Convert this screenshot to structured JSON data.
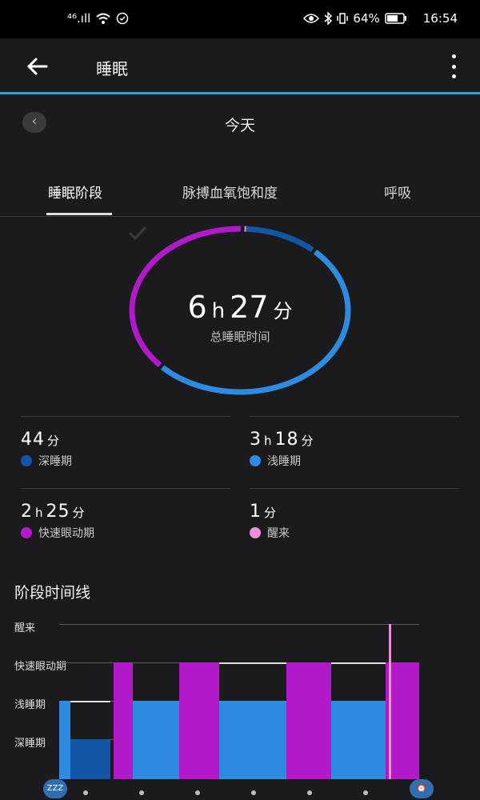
{
  "status_bar": {
    "left_text": "⁴⁶.ıll",
    "battery": "64%",
    "time": "16:54"
  },
  "header": {
    "title": "睡眠"
  },
  "date_nav": {
    "label": "今天"
  },
  "tabs": [
    {
      "label": "睡眠阶段",
      "active": true
    },
    {
      "label": "脉搏血氧饱和度",
      "active": false
    },
    {
      "label": "呼吸",
      "active": false
    }
  ],
  "summary": {
    "hours": "6",
    "hours_unit": "h",
    "minutes": "27",
    "minutes_unit": "分",
    "label": "总睡眠时间"
  },
  "stages": [
    {
      "value_main": "44",
      "value_unit": "分",
      "value_h": "",
      "value_h_unit": "",
      "label": "深睡期",
      "color": "#1356a6"
    },
    {
      "value_main": "18",
      "value_unit": "分",
      "value_h": "3",
      "value_h_unit": "h",
      "label": "浅睡期",
      "color": "#2f8be0"
    },
    {
      "value_main": "25",
      "value_unit": "分",
      "value_h": "2",
      "value_h_unit": "h",
      "label": "快速眼动期",
      "color": "#b21ac9"
    },
    {
      "value_main": "1",
      "value_unit": "分",
      "value_h": "",
      "value_h_unit": "",
      "label": "醒来",
      "color": "#f08fd8"
    }
  ],
  "timeline": {
    "title": "阶段时间线",
    "levels": [
      "醒来",
      "快速眼动期",
      "浅睡期",
      "深睡期"
    ],
    "start_icon": "zzz-icon",
    "end_icon": "alarm-clock-icon",
    "colors": {
      "deep": "#1356a6",
      "light": "#2f8be0",
      "rem": "#b21ac9",
      "awake": "#f08fd8"
    }
  },
  "chart_data": {
    "type": "bar",
    "title": "阶段时间线",
    "categories": [
      "醒来",
      "快速眼动期",
      "浅睡期",
      "深睡期"
    ],
    "donut": {
      "series": [
        {
          "name": "深睡期",
          "minutes": 44
        },
        {
          "name": "浅睡期",
          "minutes": 198
        },
        {
          "name": "快速眼动期",
          "minutes": 145
        },
        {
          "name": "醒来",
          "minutes": 1
        }
      ]
    }
  }
}
